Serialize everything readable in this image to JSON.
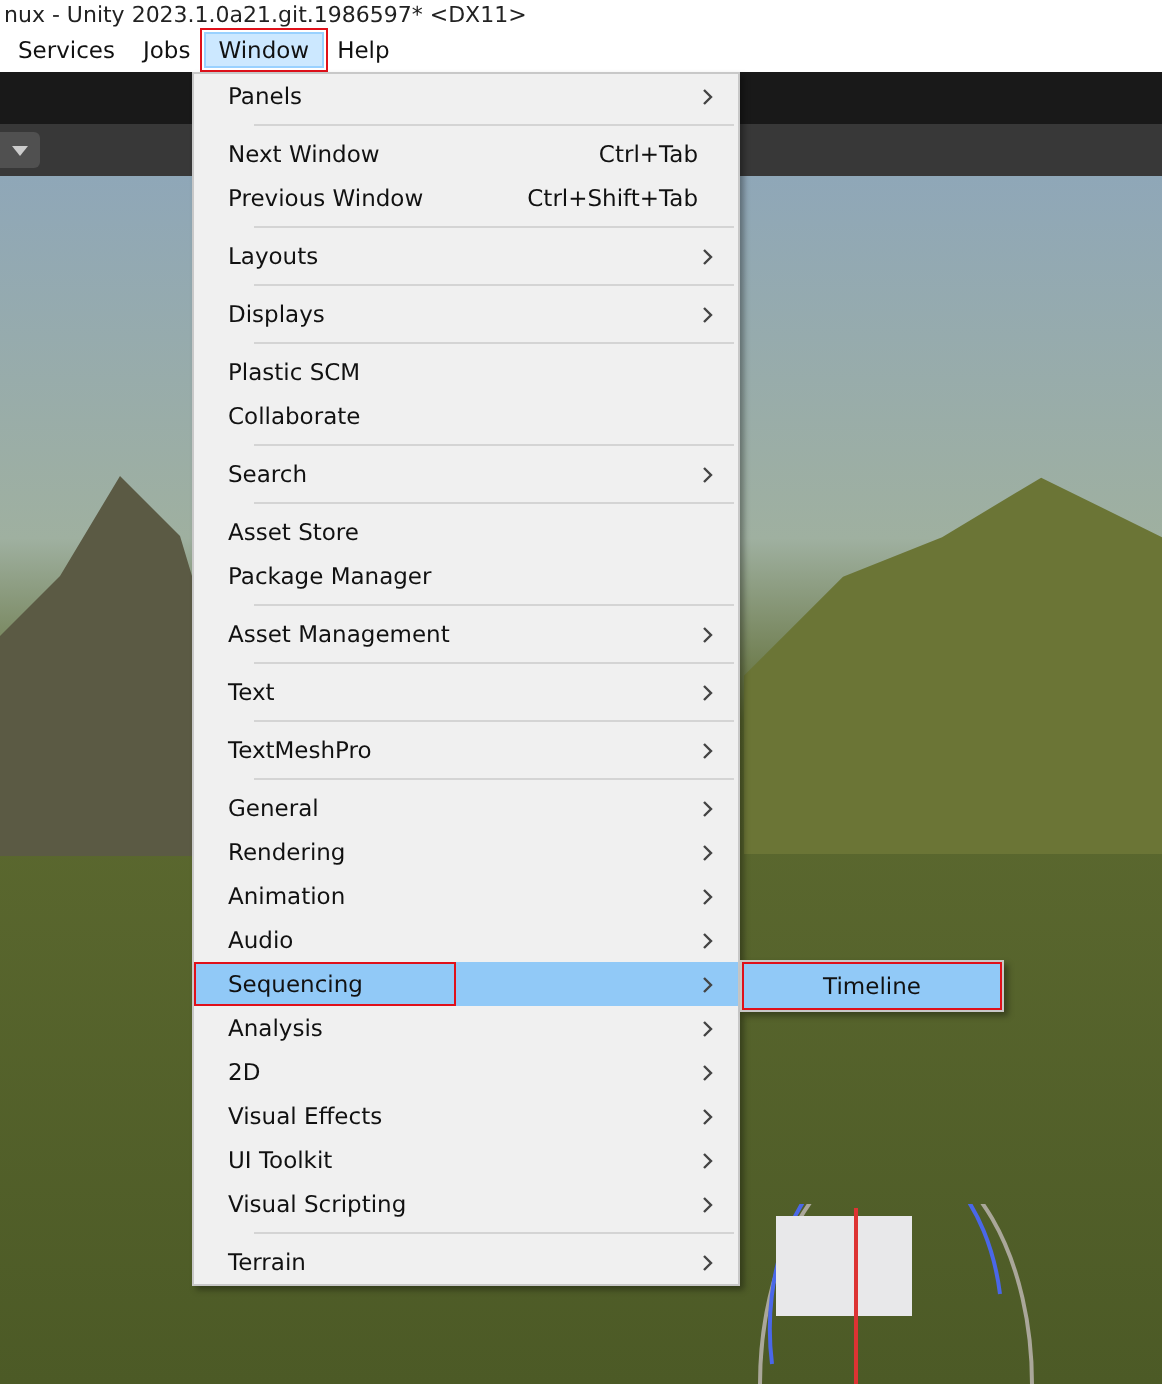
{
  "window": {
    "title": "nux - Unity 2023.1.0a21.git.1986597* <DX11>"
  },
  "menubar": [
    {
      "label": "Services",
      "selected": false,
      "outlined": false
    },
    {
      "label": "Jobs",
      "selected": false,
      "outlined": false
    },
    {
      "label": "Window",
      "selected": true,
      "outlined": true
    },
    {
      "label": "Help",
      "selected": false,
      "outlined": false
    }
  ],
  "menu": {
    "groups": [
      [
        {
          "label": "Panels",
          "submenu": true,
          "selected": false,
          "outlined": false
        }
      ],
      [
        {
          "label": "Next Window",
          "shortcut": "Ctrl+Tab",
          "submenu": false,
          "selected": false,
          "outlined": false
        },
        {
          "label": "Previous Window",
          "shortcut": "Ctrl+Shift+Tab",
          "submenu": false,
          "selected": false,
          "outlined": false
        }
      ],
      [
        {
          "label": "Layouts",
          "submenu": true,
          "selected": false,
          "outlined": false
        }
      ],
      [
        {
          "label": "Displays",
          "submenu": true,
          "selected": false,
          "outlined": false
        }
      ],
      [
        {
          "label": "Plastic SCM",
          "submenu": false,
          "selected": false,
          "outlined": false
        },
        {
          "label": "Collaborate",
          "submenu": false,
          "selected": false,
          "outlined": false
        }
      ],
      [
        {
          "label": "Search",
          "submenu": true,
          "selected": false,
          "outlined": false
        }
      ],
      [
        {
          "label": "Asset Store",
          "submenu": false,
          "selected": false,
          "outlined": false
        },
        {
          "label": "Package Manager",
          "submenu": false,
          "selected": false,
          "outlined": false
        }
      ],
      [
        {
          "label": "Asset Management",
          "submenu": true,
          "selected": false,
          "outlined": false
        }
      ],
      [
        {
          "label": "Text",
          "submenu": true,
          "selected": false,
          "outlined": false
        }
      ],
      [
        {
          "label": "TextMeshPro",
          "submenu": true,
          "selected": false,
          "outlined": false
        }
      ],
      [
        {
          "label": "General",
          "submenu": true,
          "selected": false,
          "outlined": false
        },
        {
          "label": "Rendering",
          "submenu": true,
          "selected": false,
          "outlined": false
        },
        {
          "label": "Animation",
          "submenu": true,
          "selected": false,
          "outlined": false
        },
        {
          "label": "Audio",
          "submenu": true,
          "selected": false,
          "outlined": false
        },
        {
          "label": "Sequencing",
          "submenu": true,
          "selected": true,
          "outlined": true
        },
        {
          "label": "Analysis",
          "submenu": true,
          "selected": false,
          "outlined": false
        },
        {
          "label": "2D",
          "submenu": true,
          "selected": false,
          "outlined": false
        },
        {
          "label": "Visual Effects",
          "submenu": true,
          "selected": false,
          "outlined": false
        },
        {
          "label": "UI Toolkit",
          "submenu": true,
          "selected": false,
          "outlined": false
        },
        {
          "label": "Visual Scripting",
          "submenu": true,
          "selected": false,
          "outlined": false
        }
      ],
      [
        {
          "label": "Terrain",
          "submenu": true,
          "selected": false,
          "outlined": false
        }
      ]
    ]
  },
  "submenu": {
    "items": [
      {
        "label": "Timeline",
        "selected": true,
        "outlined": true
      }
    ]
  }
}
